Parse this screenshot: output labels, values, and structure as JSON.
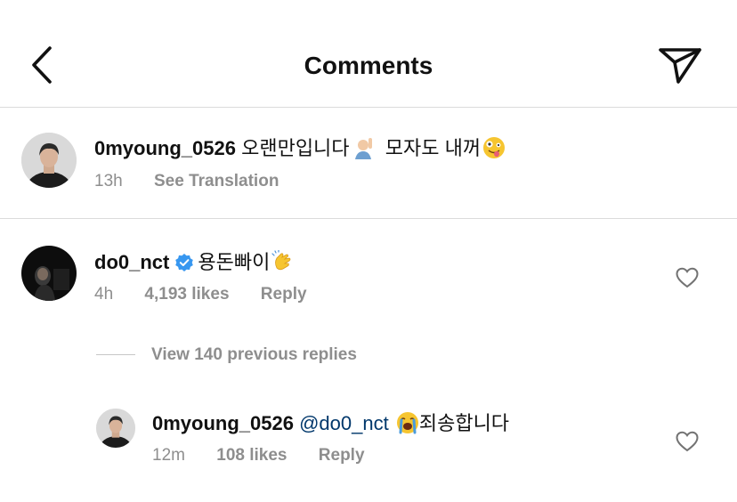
{
  "header": {
    "title": "Comments"
  },
  "caption": {
    "username": "0myoung_0526",
    "text_part1": "오랜만입니다",
    "text_part2": "모자도 내꺼",
    "time": "13h",
    "see_translation": "See Translation"
  },
  "comment": {
    "username": "do0_nct",
    "verified": true,
    "text": "용돈빠이",
    "time": "4h",
    "likes": "4,193 likes",
    "reply_label": "Reply"
  },
  "view_replies": "View 140 previous replies",
  "reply": {
    "username": "0myoung_0526",
    "mention": "@do0_nct",
    "text": "죄송합니다",
    "time": "12m",
    "likes": "108 likes",
    "reply_label": "Reply"
  },
  "colors": {
    "verified_blue": "#3797f0",
    "mention_blue": "#00376b",
    "secondary_gray": "#8e8e8e"
  },
  "icons": [
    "back-chevron-icon",
    "send-icon",
    "verified-badge-icon",
    "heart-icon"
  ]
}
